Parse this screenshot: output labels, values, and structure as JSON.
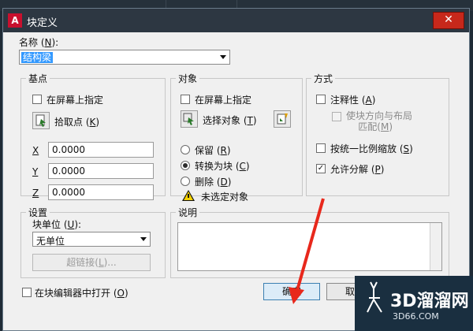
{
  "window": {
    "title": "块定义",
    "app_icon": "A"
  },
  "name": {
    "label": "名称",
    "shortcut": "N",
    "value": "结构梁"
  },
  "base_point": {
    "title": "基点",
    "specify_on_screen": "在屏幕上指定",
    "pick_point": "拾取点",
    "pick_point_key": "K",
    "x_label": "X",
    "x_value": "0.0000",
    "y_label": "Y",
    "y_value": "0.0000",
    "z_label": "Z",
    "z_value": "0.0000"
  },
  "objects": {
    "title": "对象",
    "specify_on_screen": "在屏幕上指定",
    "select_objects": "选择对象",
    "select_objects_key": "T",
    "retain": "保留",
    "retain_key": "R",
    "convert": "转换为块",
    "convert_key": "C",
    "delete": "删除",
    "delete_key": "D",
    "warning": "未选定对象"
  },
  "behavior": {
    "title": "方式",
    "annotative": "注释性",
    "annotative_key": "A",
    "match_orientation_1": "使块方向与布局",
    "match_orientation_2": "匹配",
    "match_orientation_key": "M",
    "scale_uniformly": "按统一比例缩放",
    "scale_uniformly_key": "S",
    "allow_exploding": "允许分解",
    "allow_exploding_key": "P"
  },
  "settings": {
    "title": "设置",
    "block_unit_label": "块单位",
    "block_unit_key": "U",
    "block_unit_value": "无单位",
    "hyperlink": "超链接",
    "hyperlink_key": "L"
  },
  "description": {
    "title": "说明"
  },
  "footer": {
    "open_in_editor": "在块编辑器中打开",
    "open_in_editor_key": "O",
    "ok": "确定",
    "cancel": "取消"
  },
  "watermark": {
    "line1": "3D溜溜网",
    "line2": "3D66.COM"
  },
  "colors": {
    "accent_selection": "#3399ff",
    "close": "#c7281b",
    "arrow": "#e8281c"
  }
}
